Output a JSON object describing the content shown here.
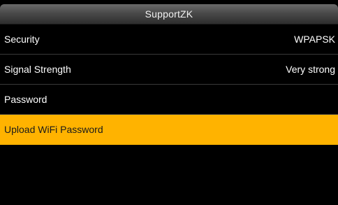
{
  "header": {
    "title": "SupportZK"
  },
  "menu": {
    "items": [
      {
        "label": "Security",
        "value": "WPAPSK"
      },
      {
        "label": "Signal Strength",
        "value": "Very strong"
      },
      {
        "label": "Password",
        "value": ""
      },
      {
        "label": "Upload WiFi Password",
        "value": ""
      }
    ],
    "selected_index": 3
  },
  "colors": {
    "background": "#000000",
    "highlight": "#ffb300",
    "text": "#ffffff"
  }
}
